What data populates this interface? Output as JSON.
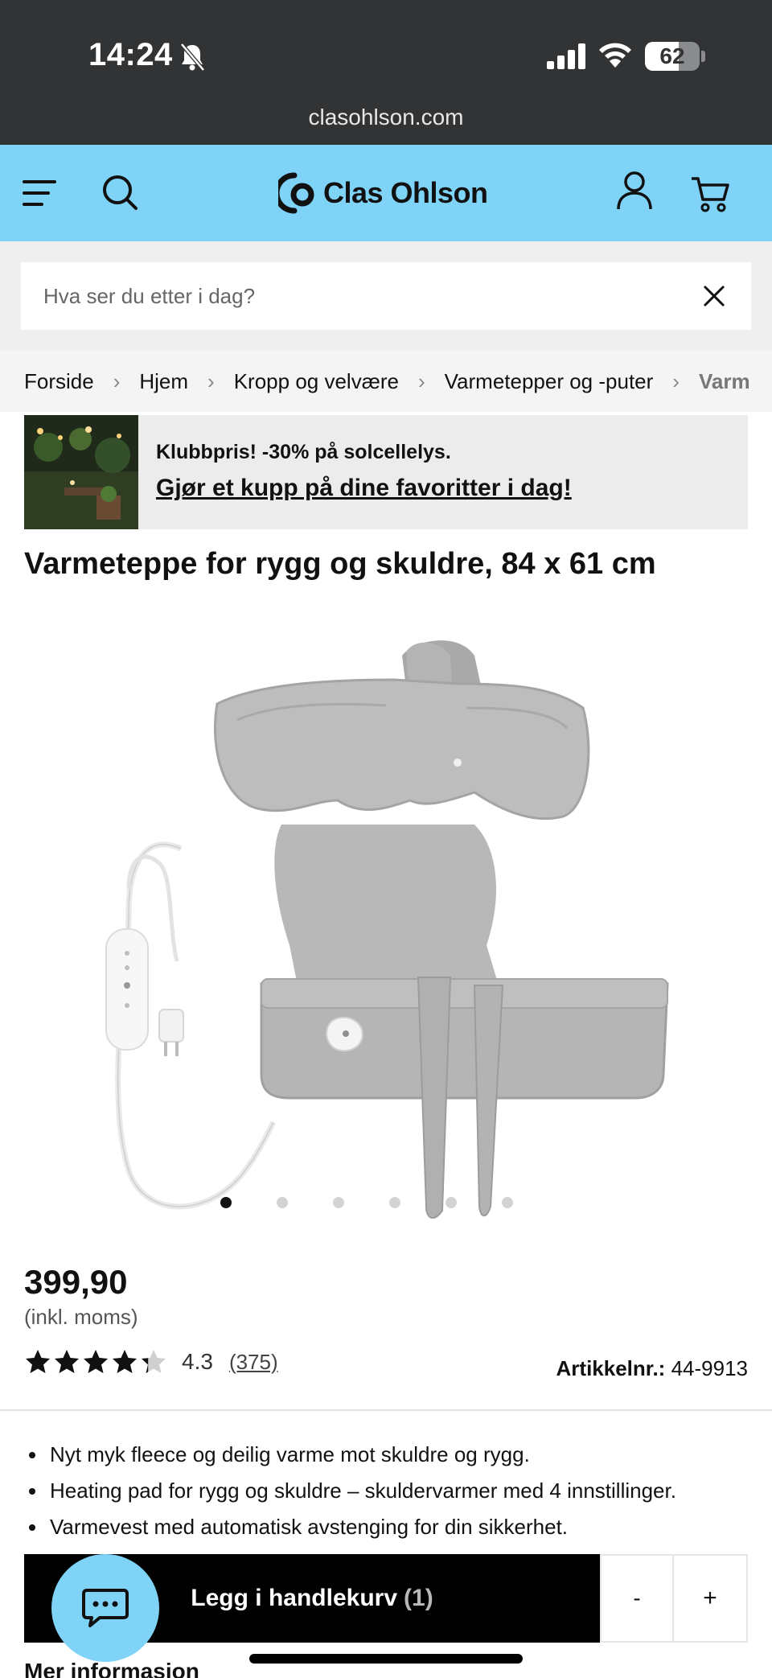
{
  "status_bar": {
    "time": "14:24",
    "battery": "62",
    "battery_level": 0.62,
    "url": "clasohlson.com"
  },
  "header": {
    "logo_text": "Clas Ohlson",
    "icons": [
      "menu-icon",
      "search-icon",
      "user-icon",
      "cart-icon"
    ],
    "background_color": "#7fd3f7"
  },
  "search": {
    "placeholder": "Hva ser du etter i dag?"
  },
  "breadcrumb": {
    "items": [
      "Forside",
      "Hjem",
      "Kropp og velvære",
      "Varmetepper og -puter",
      "Varm"
    ]
  },
  "promo": {
    "text": "Klubbpris! -30% på solcellelys.",
    "link": "Gjør et kupp på dine favoritter i dag!"
  },
  "product": {
    "title": "Varmeteppe for rygg og skuldre, 84 x 61 cm",
    "price": "399,90",
    "price_note": "(inkl. moms)",
    "rating_value": "4.3",
    "rating_stars": 4.3,
    "review_count": "(375)",
    "article_label": "Artikkelnr.:",
    "article_number": "44-9913",
    "image_count": 6,
    "active_image": 1,
    "features": [
      "Nyt myk fleece og deilig varme mot skuldre og rygg.",
      "Heating pad for rygg og skuldre – skuldervarmer med 4 innstillinger.",
      "Varmevest med automatisk avstenging for din sikkerhet."
    ]
  },
  "cart_bar": {
    "add_label": "Legg i handlekurv",
    "quantity": "(1)",
    "minus": "-",
    "plus": "+"
  },
  "more_info": "Mer informasjon"
}
